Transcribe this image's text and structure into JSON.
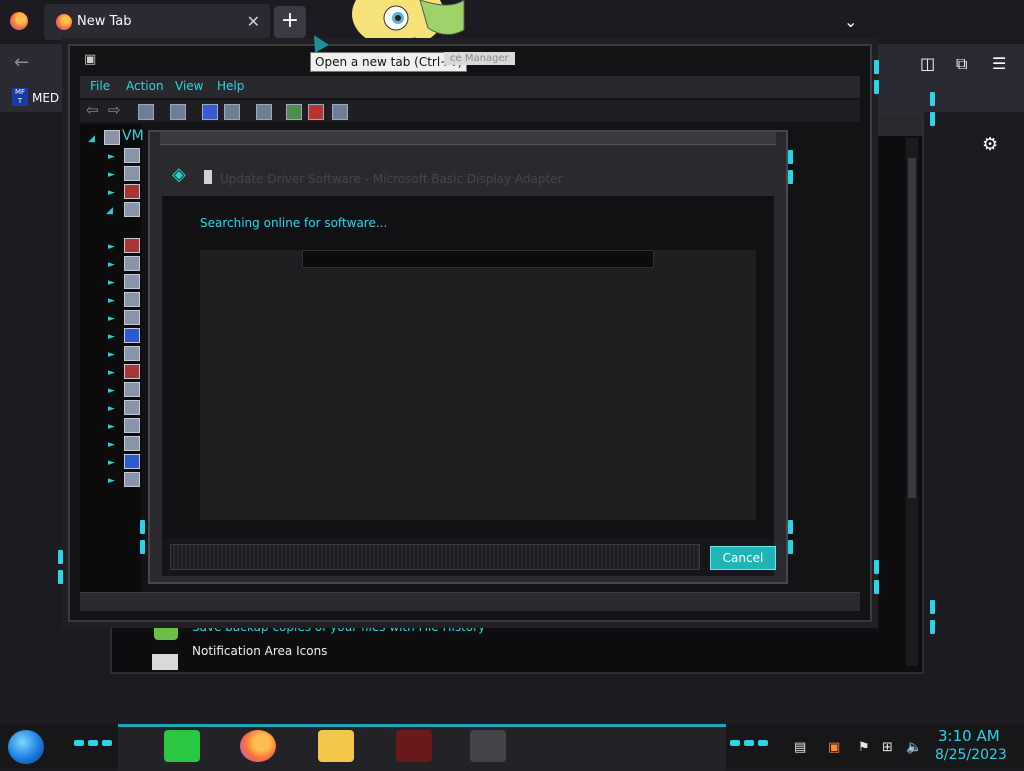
{
  "browser": {
    "tab": {
      "title": "New Tab"
    },
    "new_tab_button": "+",
    "tooltip": "Open a new tab (Ctrl+T)",
    "tooltip_obscured": "ce Manager",
    "bookmark_label": "MED",
    "bookmark_icon_text": "MF T",
    "tab_close": "✕",
    "list_all_tabs": "⌄",
    "back": "←",
    "settings": "⚙"
  },
  "device_manager": {
    "menu": [
      "File",
      "Action",
      "View",
      "Help"
    ],
    "tree_root": "VM"
  },
  "update_driver": {
    "title": "Update Driver Software - Microsoft Basic Display Adapter",
    "status": "Searching online for software...",
    "cancel_label": "Cancel"
  },
  "control_panel": {
    "file_history_link": "Save backup copies of your files with File History",
    "notification_heading": "Notification Area Icons"
  },
  "taskbar": {
    "time": "3:10 AM",
    "date": "8/25/2023"
  },
  "colors": {
    "accent": "#2ad6e6",
    "cancel_button": "#1fb5b8"
  }
}
